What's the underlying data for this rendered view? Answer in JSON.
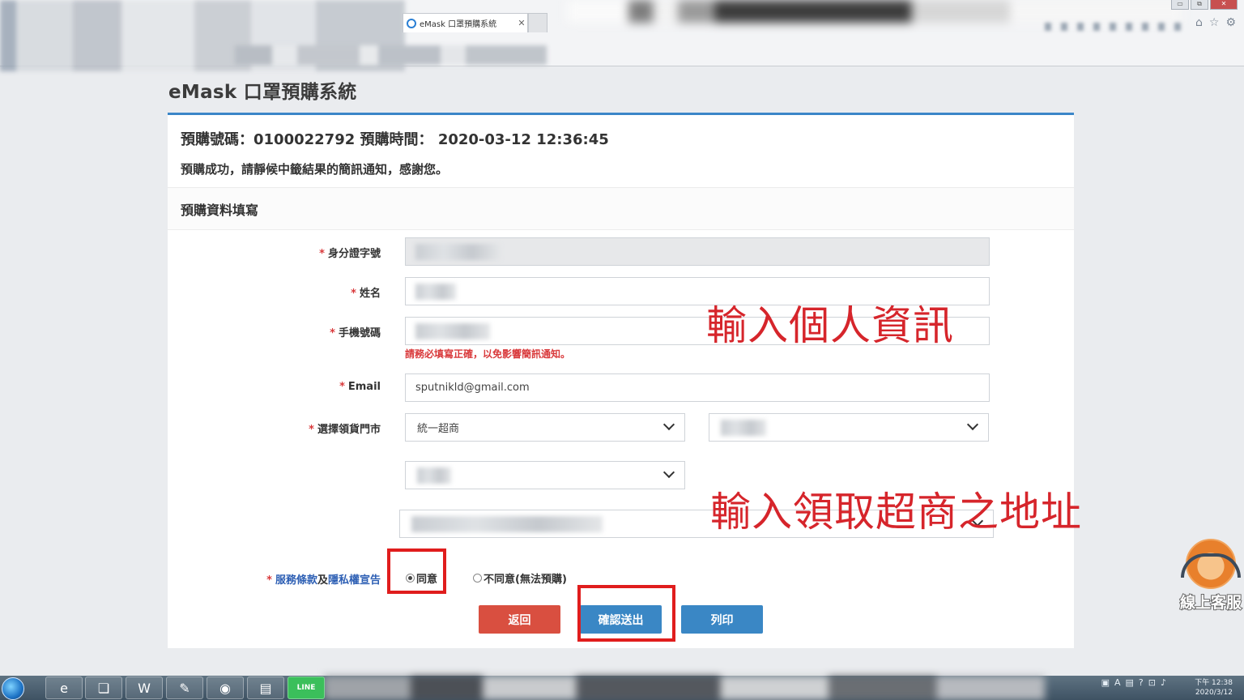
{
  "browser": {
    "tab_title": "eMask 口罩預購系統",
    "tab_close": "✕",
    "window_buttons": [
      "▭",
      "⧉",
      "✕"
    ],
    "toolbar_icons": [
      "home-icon",
      "star-icon",
      "gear-icon"
    ],
    "toolbar_glyphs": [
      "⌂",
      "☆",
      "⚙"
    ]
  },
  "page": {
    "app_title": "eMask 口罩預購系統",
    "order_label": "預購號碼：",
    "order_number": "0100022792",
    "order_time_label": "預購時間：",
    "order_time": "2020-03-12 12:36:45",
    "success_message": "預購成功，請靜候中籤結果的簡訊通知，感謝您。",
    "section_title": "預購資料填寫"
  },
  "form": {
    "required_mark": "*",
    "id_label": "身分證字號",
    "name_label": "姓名",
    "phone_label": "手機號碼",
    "phone_hint": "請務必填寫正確，以免影響簡訊通知。",
    "email_label": "Email",
    "email_value": "sputnikld@gmail.com",
    "store_label": "選擇領貨門市",
    "store_chain": "統一超商",
    "tos_link": "服務條款",
    "tos_and": "及",
    "privacy_link": "隱私權宣告",
    "agree_label": "同意",
    "disagree_label": "不同意(無法預購)",
    "back_button": "返回",
    "submit_button": "確認送出",
    "print_button": "列印"
  },
  "annotations": {
    "personal_info": "輸入個人資訊",
    "store_address": "輸入領取超商之地址"
  },
  "widget": {
    "customer_service": "線上客服"
  },
  "taskbar": {
    "clock_time": "下午 12:38",
    "clock_date": "2020/3/12",
    "items": [
      "ie-icon",
      "folder-icon",
      "word-icon",
      "paint-icon",
      "chrome-icon",
      "explorer-icon",
      "line-icon"
    ],
    "item_glyphs": [
      "e",
      "❏",
      "W",
      "✎",
      "◉",
      "▤",
      "✉"
    ],
    "line_label": "LINE"
  },
  "colors": {
    "accent": "#3b86c8",
    "danger": "#d94f40",
    "required": "#d9393b",
    "annotation": "#d6252b"
  }
}
